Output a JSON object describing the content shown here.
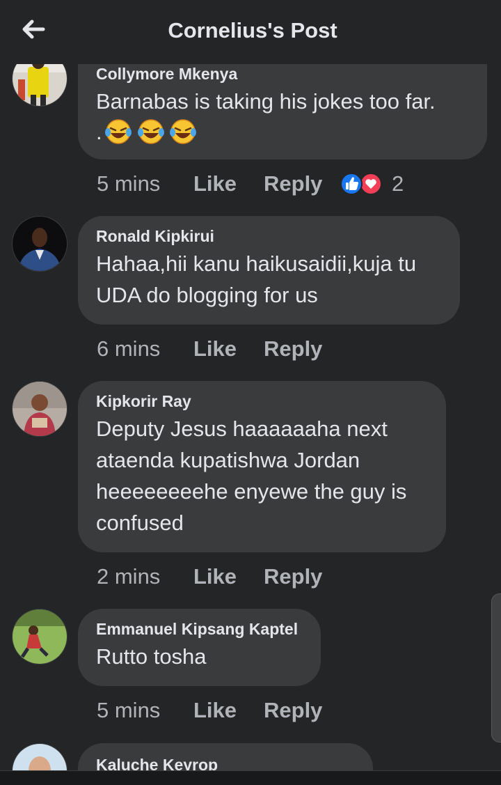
{
  "header": {
    "title": "Cornelius's Post",
    "back_icon": "arrow-left-icon"
  },
  "comments": [
    {
      "author": "Collymore Mkenya",
      "text": "Barnabas is taking his jokes too far.",
      "time": "5 mins",
      "like": "Like",
      "reply": "Reply",
      "reactions": [
        "like-reaction-icon",
        "love-reaction-icon"
      ],
      "reaction_count": "2"
    },
    {
      "author": "Ronald Kipkirui",
      "text": "Hahaa,hii kanu haikusaidii,kuja tu UDA do blogging for us",
      "time": "6 mins",
      "like": "Like",
      "reply": "Reply"
    },
    {
      "author": "Kipkorir Ray",
      "text": "Deputy Jesus haaaaaaha next ataenda kupatishwa Jordan heeeeeeeehe enyewe the guy is confused",
      "time": "2 mins",
      "like": "Like",
      "reply": "Reply"
    },
    {
      "author": "Emmanuel Kipsang Kaptel",
      "text": "Rutto tosha",
      "time": "5 mins",
      "like": "Like",
      "reply": "Reply"
    },
    {
      "author": "Kaluche Keyrop"
    }
  ],
  "emoji": {
    "laughing": "laughing-emoji-icon",
    "count": 3,
    "prefix": "."
  },
  "colors": {
    "background": "#242526",
    "bubble": "#3a3b3c",
    "text": "#e4e6eb",
    "muted": "#b0b3b8",
    "like_blue": "#1877f2",
    "love_red": "#f33e58"
  }
}
